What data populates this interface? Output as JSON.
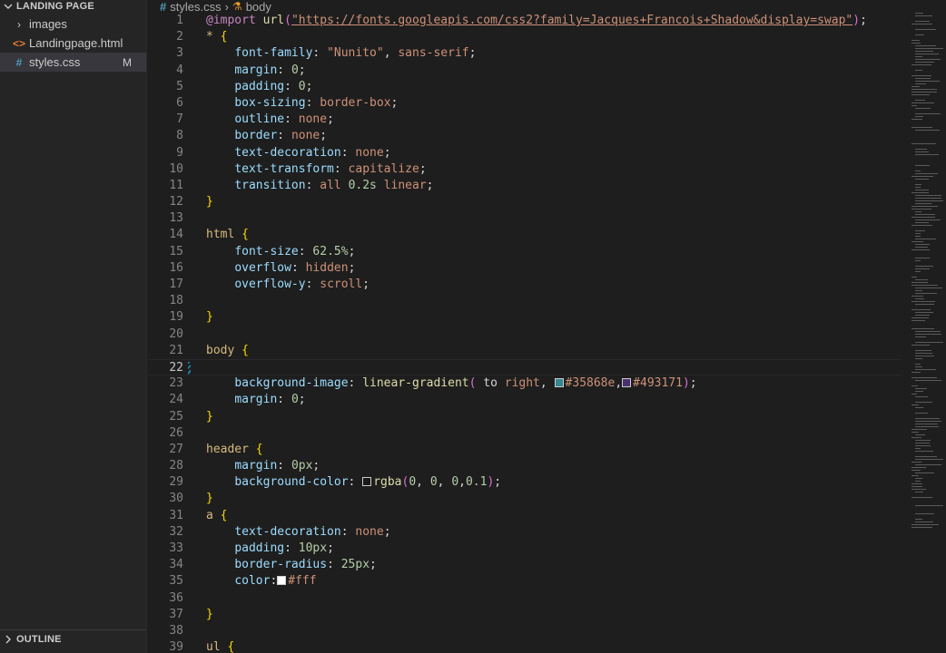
{
  "explorer": {
    "section_title": "LANDING PAGE",
    "items": [
      {
        "label": "images",
        "type": "folder"
      },
      {
        "label": "Landingpage.html",
        "type": "html"
      },
      {
        "label": "styles.css",
        "type": "css",
        "badge": "M"
      }
    ],
    "outline_title": "OUTLINE"
  },
  "breadcrumb": {
    "file": "styles.css",
    "symbol": "body"
  },
  "editor": {
    "current_line": 22,
    "lines": [
      {
        "n": "1",
        "tokens": [
          {
            "c": "at",
            "t": "@import"
          },
          {
            "c": "p",
            "t": " "
          },
          {
            "c": "fn",
            "t": "url"
          },
          {
            "c": "paren",
            "t": "("
          },
          {
            "c": "url",
            "t": "\"https://fonts.googleapis.com/css2?family=Jacques+Francois+Shadow&display=swap\""
          },
          {
            "c": "paren",
            "t": ")"
          },
          {
            "c": "p",
            "t": ";"
          }
        ]
      },
      {
        "n": "2",
        "tokens": [
          {
            "c": "sel",
            "t": "*"
          },
          {
            "c": "p",
            "t": " "
          },
          {
            "c": "brace",
            "t": "{"
          }
        ]
      },
      {
        "n": "3",
        "tokens": [
          {
            "c": "p",
            "t": "    "
          },
          {
            "c": "prop",
            "t": "font-family"
          },
          {
            "c": "p",
            "t": ": "
          },
          {
            "c": "str",
            "t": "\"Nunito\""
          },
          {
            "c": "p",
            "t": ", "
          },
          {
            "c": "val",
            "t": "sans-serif"
          },
          {
            "c": "p",
            "t": ";"
          }
        ]
      },
      {
        "n": "4",
        "tokens": [
          {
            "c": "p",
            "t": "    "
          },
          {
            "c": "prop",
            "t": "margin"
          },
          {
            "c": "p",
            "t": ": "
          },
          {
            "c": "num",
            "t": "0"
          },
          {
            "c": "p",
            "t": ";"
          }
        ]
      },
      {
        "n": "5",
        "tokens": [
          {
            "c": "p",
            "t": "    "
          },
          {
            "c": "prop",
            "t": "padding"
          },
          {
            "c": "p",
            "t": ": "
          },
          {
            "c": "num",
            "t": "0"
          },
          {
            "c": "p",
            "t": ";"
          }
        ]
      },
      {
        "n": "6",
        "tokens": [
          {
            "c": "p",
            "t": "    "
          },
          {
            "c": "prop",
            "t": "box-sizing"
          },
          {
            "c": "p",
            "t": ": "
          },
          {
            "c": "val",
            "t": "border-box"
          },
          {
            "c": "p",
            "t": ";"
          }
        ]
      },
      {
        "n": "7",
        "tokens": [
          {
            "c": "p",
            "t": "    "
          },
          {
            "c": "prop",
            "t": "outline"
          },
          {
            "c": "p",
            "t": ": "
          },
          {
            "c": "val",
            "t": "none"
          },
          {
            "c": "p",
            "t": ";"
          }
        ]
      },
      {
        "n": "8",
        "tokens": [
          {
            "c": "p",
            "t": "    "
          },
          {
            "c": "prop",
            "t": "border"
          },
          {
            "c": "p",
            "t": ": "
          },
          {
            "c": "val",
            "t": "none"
          },
          {
            "c": "p",
            "t": ";"
          }
        ]
      },
      {
        "n": "9",
        "tokens": [
          {
            "c": "p",
            "t": "    "
          },
          {
            "c": "prop",
            "t": "text-decoration"
          },
          {
            "c": "p",
            "t": ": "
          },
          {
            "c": "val",
            "t": "none"
          },
          {
            "c": "p",
            "t": ";"
          }
        ]
      },
      {
        "n": "10",
        "tokens": [
          {
            "c": "p",
            "t": "    "
          },
          {
            "c": "prop",
            "t": "text-transform"
          },
          {
            "c": "p",
            "t": ": "
          },
          {
            "c": "val",
            "t": "capitalize"
          },
          {
            "c": "p",
            "t": ";"
          }
        ]
      },
      {
        "n": "11",
        "tokens": [
          {
            "c": "p",
            "t": "    "
          },
          {
            "c": "prop",
            "t": "transition"
          },
          {
            "c": "p",
            "t": ": "
          },
          {
            "c": "val",
            "t": "all"
          },
          {
            "c": "p",
            "t": " "
          },
          {
            "c": "num",
            "t": "0.2s"
          },
          {
            "c": "p",
            "t": " "
          },
          {
            "c": "val",
            "t": "linear"
          },
          {
            "c": "p",
            "t": ";"
          }
        ]
      },
      {
        "n": "12",
        "tokens": [
          {
            "c": "brace",
            "t": "}"
          }
        ]
      },
      {
        "n": "13",
        "tokens": []
      },
      {
        "n": "14",
        "tokens": [
          {
            "c": "tag",
            "t": "html"
          },
          {
            "c": "p",
            "t": " "
          },
          {
            "c": "brace",
            "t": "{"
          }
        ]
      },
      {
        "n": "15",
        "tokens": [
          {
            "c": "p",
            "t": "    "
          },
          {
            "c": "prop",
            "t": "font-size"
          },
          {
            "c": "p",
            "t": ": "
          },
          {
            "c": "num",
            "t": "62.5%"
          },
          {
            "c": "p",
            "t": ";"
          }
        ]
      },
      {
        "n": "16",
        "tokens": [
          {
            "c": "p",
            "t": "    "
          },
          {
            "c": "prop",
            "t": "overflow"
          },
          {
            "c": "p",
            "t": ": "
          },
          {
            "c": "val",
            "t": "hidden"
          },
          {
            "c": "p",
            "t": ";"
          }
        ]
      },
      {
        "n": "17",
        "tokens": [
          {
            "c": "p",
            "t": "    "
          },
          {
            "c": "prop",
            "t": "overflow-y"
          },
          {
            "c": "p",
            "t": ": "
          },
          {
            "c": "val",
            "t": "scroll"
          },
          {
            "c": "p",
            "t": ";"
          }
        ]
      },
      {
        "n": "18",
        "tokens": []
      },
      {
        "n": "19",
        "tokens": [
          {
            "c": "brace",
            "t": "}"
          }
        ]
      },
      {
        "n": "20",
        "tokens": []
      },
      {
        "n": "21",
        "tokens": [
          {
            "c": "tag",
            "t": "body"
          },
          {
            "c": "p",
            "t": " "
          },
          {
            "c": "brace",
            "t": "{"
          }
        ]
      },
      {
        "n": "22",
        "tokens": []
      },
      {
        "n": "23",
        "tokens": [
          {
            "c": "p",
            "t": "    "
          },
          {
            "c": "prop",
            "t": "background-image"
          },
          {
            "c": "p",
            "t": ": "
          },
          {
            "c": "fn",
            "t": "linear-gradient"
          },
          {
            "c": "paren",
            "t": "("
          },
          {
            "c": "p",
            "t": " to "
          },
          {
            "c": "val",
            "t": "right"
          },
          {
            "c": "p",
            "t": ", "
          },
          {
            "sw": "#35868e"
          },
          {
            "c": "val",
            "t": "#35868e"
          },
          {
            "c": "p",
            "t": ","
          },
          {
            "sw": "#493171"
          },
          {
            "c": "val",
            "t": "#493171"
          },
          {
            "c": "paren",
            "t": ")"
          },
          {
            "c": "p",
            "t": ";"
          }
        ]
      },
      {
        "n": "24",
        "tokens": [
          {
            "c": "p",
            "t": "    "
          },
          {
            "c": "prop",
            "t": "margin"
          },
          {
            "c": "p",
            "t": ": "
          },
          {
            "c": "num",
            "t": "0"
          },
          {
            "c": "p",
            "t": ";"
          }
        ]
      },
      {
        "n": "25",
        "tokens": [
          {
            "c": "brace",
            "t": "}"
          }
        ]
      },
      {
        "n": "26",
        "tokens": []
      },
      {
        "n": "27",
        "tokens": [
          {
            "c": "tag",
            "t": "header"
          },
          {
            "c": "p",
            "t": " "
          },
          {
            "c": "brace",
            "t": "{"
          }
        ]
      },
      {
        "n": "28",
        "tokens": [
          {
            "c": "p",
            "t": "    "
          },
          {
            "c": "prop",
            "t": "margin"
          },
          {
            "c": "p",
            "t": ": "
          },
          {
            "c": "num",
            "t": "0px"
          },
          {
            "c": "p",
            "t": ";"
          }
        ]
      },
      {
        "n": "29",
        "tokens": [
          {
            "c": "p",
            "t": "    "
          },
          {
            "c": "prop",
            "t": "background-color"
          },
          {
            "c": "p",
            "t": ": "
          },
          {
            "sw": "rgba(0,0,0,0.1)"
          },
          {
            "c": "fn",
            "t": "rgba"
          },
          {
            "c": "paren",
            "t": "("
          },
          {
            "c": "num",
            "t": "0"
          },
          {
            "c": "p",
            "t": ", "
          },
          {
            "c": "num",
            "t": "0"
          },
          {
            "c": "p",
            "t": ", "
          },
          {
            "c": "num",
            "t": "0"
          },
          {
            "c": "p",
            "t": ","
          },
          {
            "c": "num",
            "t": "0.1"
          },
          {
            "c": "paren",
            "t": ")"
          },
          {
            "c": "p",
            "t": ";"
          }
        ]
      },
      {
        "n": "30",
        "tokens": [
          {
            "c": "brace",
            "t": "}"
          }
        ]
      },
      {
        "n": "31",
        "tokens": [
          {
            "c": "tag",
            "t": "a"
          },
          {
            "c": "p",
            "t": " "
          },
          {
            "c": "brace",
            "t": "{"
          }
        ]
      },
      {
        "n": "32",
        "tokens": [
          {
            "c": "p",
            "t": "    "
          },
          {
            "c": "prop",
            "t": "text-decoration"
          },
          {
            "c": "p",
            "t": ": "
          },
          {
            "c": "val",
            "t": "none"
          },
          {
            "c": "p",
            "t": ";"
          }
        ]
      },
      {
        "n": "33",
        "tokens": [
          {
            "c": "p",
            "t": "    "
          },
          {
            "c": "prop",
            "t": "padding"
          },
          {
            "c": "p",
            "t": ": "
          },
          {
            "c": "num",
            "t": "10px"
          },
          {
            "c": "p",
            "t": ";"
          }
        ]
      },
      {
        "n": "34",
        "tokens": [
          {
            "c": "p",
            "t": "    "
          },
          {
            "c": "prop",
            "t": "border-radius"
          },
          {
            "c": "p",
            "t": ": "
          },
          {
            "c": "num",
            "t": "25px"
          },
          {
            "c": "p",
            "t": ";"
          }
        ]
      },
      {
        "n": "35",
        "tokens": [
          {
            "c": "p",
            "t": "    "
          },
          {
            "c": "prop",
            "t": "color"
          },
          {
            "c": "p",
            "t": ":"
          },
          {
            "sw": "#ffffff"
          },
          {
            "c": "val",
            "t": "#fff"
          }
        ]
      },
      {
        "n": "36",
        "tokens": []
      },
      {
        "n": "37",
        "tokens": [
          {
            "c": "brace",
            "t": "}"
          }
        ]
      },
      {
        "n": "38",
        "tokens": []
      },
      {
        "n": "39",
        "tokens": [
          {
            "c": "tag",
            "t": "ul"
          },
          {
            "c": "p",
            "t": " "
          },
          {
            "c": "brace",
            "t": "{"
          }
        ]
      }
    ]
  },
  "icons": {
    "chevron_down": "chevron-down-icon",
    "chevron_right": "chevron-right-icon",
    "html_file": "html-file-icon",
    "css_file": "css-file-icon",
    "symbol": "symbol-class-icon"
  },
  "colors": {
    "editor_bg": "#1e1e1e",
    "sidebar_bg": "#252526",
    "css_icon": "#519aba",
    "html_icon": "#e37933",
    "modified_gutter": "#1b81a8"
  }
}
